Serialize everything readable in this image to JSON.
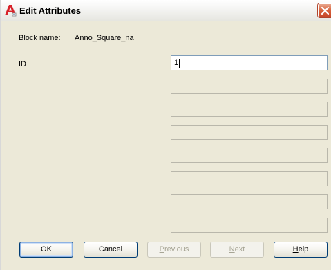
{
  "window": {
    "title": "Edit Attributes",
    "icon": "autocad-a-icon",
    "close_icon": "close-x-icon"
  },
  "block": {
    "label": "Block name:",
    "value": "Anno_Square_na"
  },
  "attributes": [
    {
      "label": "ID",
      "value": "1",
      "enabled": true
    }
  ],
  "empty_field_count_visible": 7,
  "buttons": {
    "ok": {
      "label": "OK"
    },
    "cancel": {
      "label": "Cancel"
    },
    "previous": {
      "mnemonic": "P",
      "rest": "revious",
      "enabled": false
    },
    "next": {
      "mnemonic": "N",
      "rest": "ext",
      "enabled": false
    },
    "help": {
      "mnemonic": "H",
      "rest": "elp"
    }
  },
  "colors": {
    "dialog_bg": "#ece9d8",
    "button_border": "#003c74",
    "close_button": "#d7623c",
    "icon_red": "#d8222a"
  }
}
